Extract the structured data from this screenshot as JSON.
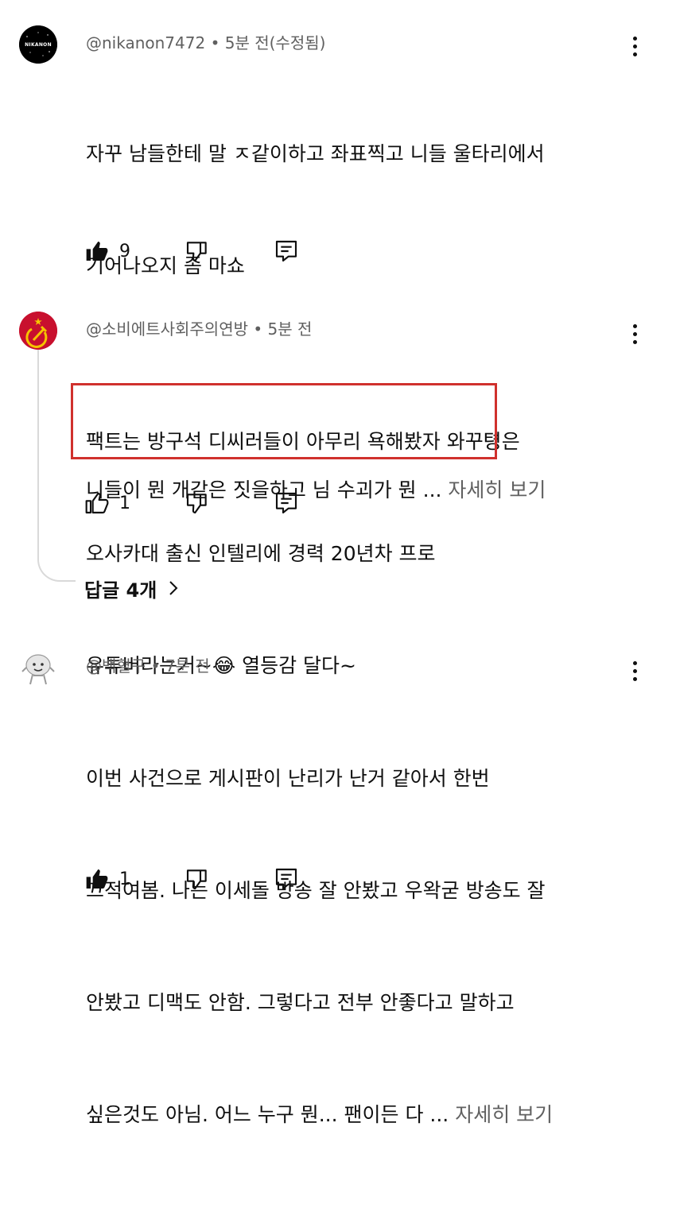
{
  "comments": [
    {
      "handle": "@nikanon7472",
      "time": "5분 전(수정됨)",
      "avatar_text": "NIKANON",
      "lines": [
        "자꾸 남들한테 말 ㅈ같이하고 좌표찍고 니들 울타리에서",
        "기어나오지 좀 마쇼",
        "",
        "니들이 뭔 개같은 짓을하고 님 수괴가 뭔 ... "
      ],
      "more": "자세히 보기",
      "likes": "9"
    },
    {
      "handle": "@소비에트사회주의연방",
      "time": "5분 전",
      "lines": [
        "팩트는 방구석 디씨러들이 아무리 욕해봤자 와꾸텽은",
        "오사카대 출신 인텔리에 경력 20년차 프로",
        "유튜버라는거~😂 열등감 달다~"
      ],
      "likes": "1",
      "replies": "답글 4개"
    },
    {
      "handle": "@백혈구",
      "time": "7분 전",
      "lines": [
        "이번 사건으로 게시판이 난리가 난거 같아서 한번",
        "끄적여봄. 나는 이세돌 방송 잘 안봤고 우왁굳 방송도 잘",
        "안봤고 디맥도 안함. 그렇다고 전부 안좋다고 말하고",
        "싶은것도 아님. 어느 누구 뭔... 팬이든 다 ... "
      ],
      "more": "자세히 보기",
      "likes": "1"
    }
  ],
  "separator": "•",
  "colors": {
    "highlight": "#d0312d",
    "meta": "#606060",
    "text": "#0f0f0f"
  }
}
